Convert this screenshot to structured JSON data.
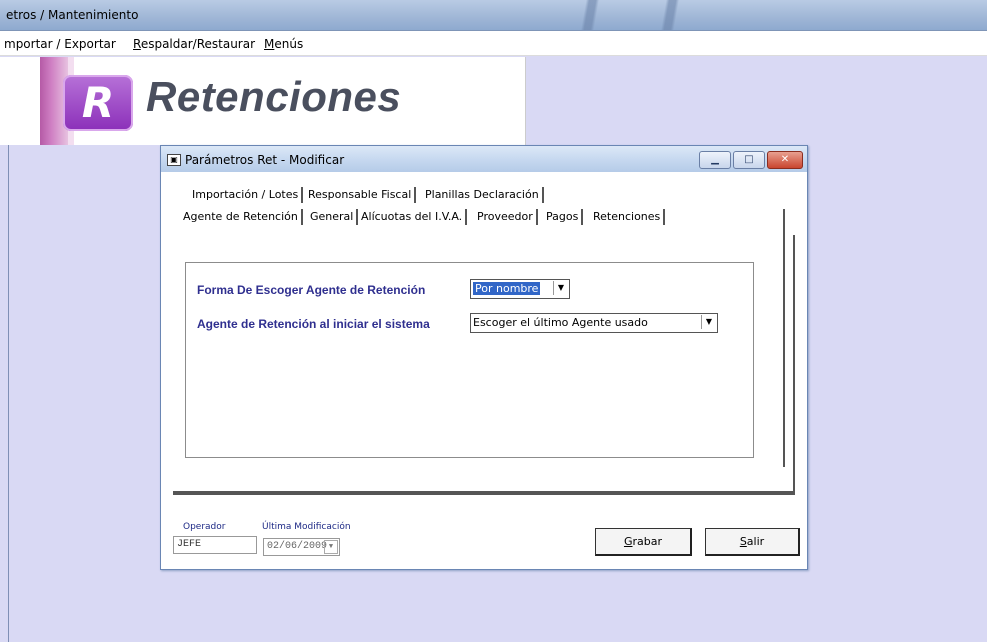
{
  "outer_window": {
    "title": "etros / Mantenimiento"
  },
  "menu": [
    "mportar / Exportar",
    "Respaldar/Restaurar",
    "Menús"
  ],
  "banner": {
    "logo_letter": "R",
    "app_name": "Retenciones"
  },
  "dialog": {
    "title": "Parámetros Ret - Modificar",
    "tabs_row1": [
      "Importación / Lotes",
      "Responsable Fiscal",
      "Planillas Declaración"
    ],
    "tabs_row2": [
      "Agente de Retención",
      "General",
      "Alícuotas del I.V.A.",
      "Proveedor",
      "Pagos",
      "Retenciones"
    ],
    "fields": {
      "forma_label": "Forma De Escoger Agente de Retención",
      "forma_value": "Por nombre",
      "agente_label": "Agente de Retención al iniciar el sistema",
      "agente_value": "Escoger el último Agente usado"
    },
    "footer": {
      "operador_label": "Operador",
      "operador_value": "JEFE",
      "ultima_label": "Última Modificación",
      "ultima_value": "02/06/2009",
      "grabar": "Grabar",
      "salir": "Salir"
    }
  },
  "colors": {
    "desktop": "#d9d9f4",
    "label": "#2f2f8f",
    "selection": "#3166c7"
  }
}
